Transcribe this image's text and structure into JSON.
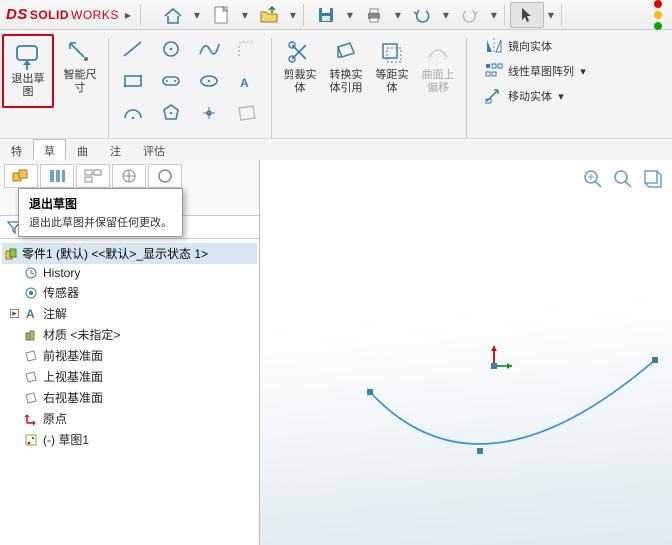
{
  "app": {
    "brand_prefix": "DS",
    "brand": "SOLID",
    "brand_thin": "WORKS"
  },
  "ribbon": {
    "exit_sketch": "退出草\n图",
    "smart_dim": "智能尺\n寸",
    "trim": "剪裁实\n体",
    "convert": "转换实\n体引用",
    "offset": "等距实\n体",
    "curve_offset": "曲面上\n偏移",
    "mirror": "镜向实体",
    "pattern": "线性草图阵列",
    "move": "移动实体"
  },
  "tabs": {
    "t1": "特",
    "t2": "草",
    "t3": "曲",
    "t4": "注",
    "t5": "评估"
  },
  "tooltip": {
    "title": "退出草图",
    "body": "退出此草图并保留任何更改。"
  },
  "tree": {
    "root": "零件1 (默认) <<默认>_显示状态 1>",
    "history": "History",
    "sensors": "传感器",
    "annotations": "注解",
    "material": "材质 <未指定>",
    "front": "前视基准面",
    "top": "上视基准面",
    "right": "右视基准面",
    "origin": "原点",
    "sketch1": "(-) 草图1"
  }
}
